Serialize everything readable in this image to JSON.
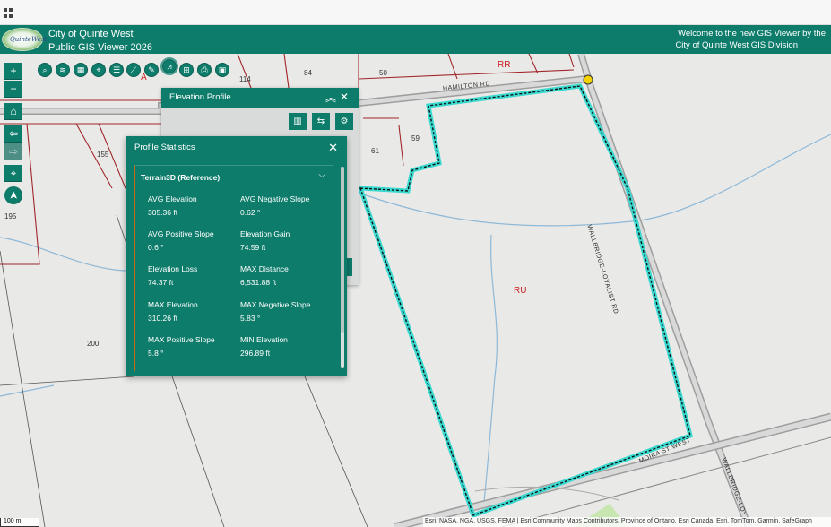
{
  "header": {
    "title_line1": "City of Quinte West",
    "title_line2": "Public GIS Viewer 2026",
    "logo_text": "QuinteWest",
    "welcome_line1": "Welcome to the new GIS Viewer by the",
    "welcome_line2": "City of Quinte West GIS Division"
  },
  "toolbar": {
    "tools": [
      {
        "name": "search-icon",
        "glyph": "⌕"
      },
      {
        "name": "layers-icon",
        "glyph": "≋"
      },
      {
        "name": "basemap-icon",
        "glyph": "▦"
      },
      {
        "name": "location-icon",
        "glyph": "⌖"
      },
      {
        "name": "list-icon",
        "glyph": "☰"
      },
      {
        "name": "measure-icon",
        "glyph": "⟋"
      },
      {
        "name": "draw-icon",
        "glyph": "✎"
      },
      {
        "name": "elevation-icon",
        "glyph": "⩘"
      },
      {
        "name": "analysis-icon",
        "glyph": "⊞"
      },
      {
        "name": "print-icon",
        "glyph": "⎙"
      },
      {
        "name": "image-icon",
        "glyph": "▣"
      }
    ]
  },
  "nav": {
    "zoom_in": "+",
    "zoom_out": "−",
    "home": "⌂",
    "back": "⇦",
    "forward": "⇨",
    "locate": "⌖",
    "compass": "➤"
  },
  "map": {
    "parcel_labels": [
      "84",
      "50",
      "114",
      "59",
      "61",
      "155",
      "195",
      "200"
    ],
    "zone_labels": [
      "RR",
      "A",
      "RU"
    ],
    "road_labels": [
      "HAMILTON RD",
      "WALLBRIDGE-LOYALIST RD",
      "MOIRA ST WEST",
      "WALLBRIDGE-LOY"
    ],
    "scale": "100 m",
    "attribution": "Esri, NASA, NGA, USGS, FEMA | Esri Community Maps Contributors, Province of Ontario, Esri Canada, Esri, TomTom, Garmin, SafeGraph"
  },
  "elevation_profile": {
    "title": "Elevation Profile"
  },
  "profile_statistics": {
    "title": "Profile Statistics",
    "section": "Terrain3D (Reference)",
    "stats": [
      {
        "label": "AVG Elevation",
        "value": "305.36 ft"
      },
      {
        "label": "AVG Negative Slope",
        "value": "0.62 °"
      },
      {
        "label": "AVG Positive Slope",
        "value": "0.6 °"
      },
      {
        "label": "Elevation Gain",
        "value": "74.59 ft"
      },
      {
        "label": "Elevation Loss",
        "value": "74.37 ft"
      },
      {
        "label": "MAX Distance",
        "value": "6,531.88 ft"
      },
      {
        "label": "MAX Elevation",
        "value": "310.26 ft"
      },
      {
        "label": "MAX Negative Slope",
        "value": "5.83 °"
      },
      {
        "label": "MAX Positive Slope",
        "value": "5.8 °"
      },
      {
        "label": "MIN Elevation",
        "value": "296.89 ft"
      }
    ]
  },
  "colors": {
    "brand": "#0e7c6b",
    "parcel_line": "#a1262b",
    "highlight": "#39d9d0"
  }
}
